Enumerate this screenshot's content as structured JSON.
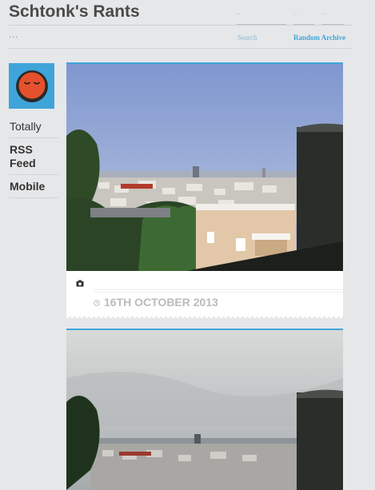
{
  "header": {
    "blog_title": "Schtonk's Rants",
    "dots": "...",
    "search_label": "Search",
    "random_archive_label": "Random Archive",
    "field_hint": "..."
  },
  "sidebar": {
    "links": [
      "Totally",
      "RSS",
      "Feed",
      "Mobile"
    ]
  },
  "posts": [
    {
      "date": "16TH OCTOBER 2013",
      "type_icon": "camera-icon"
    },
    {
      "type_icon": "camera-icon"
    }
  ],
  "colors": {
    "accent": "#3fa6d8",
    "background": "#e6e7e9",
    "avatar_bg": "#3fa4d9",
    "avatar_face": "#e5512c"
  }
}
